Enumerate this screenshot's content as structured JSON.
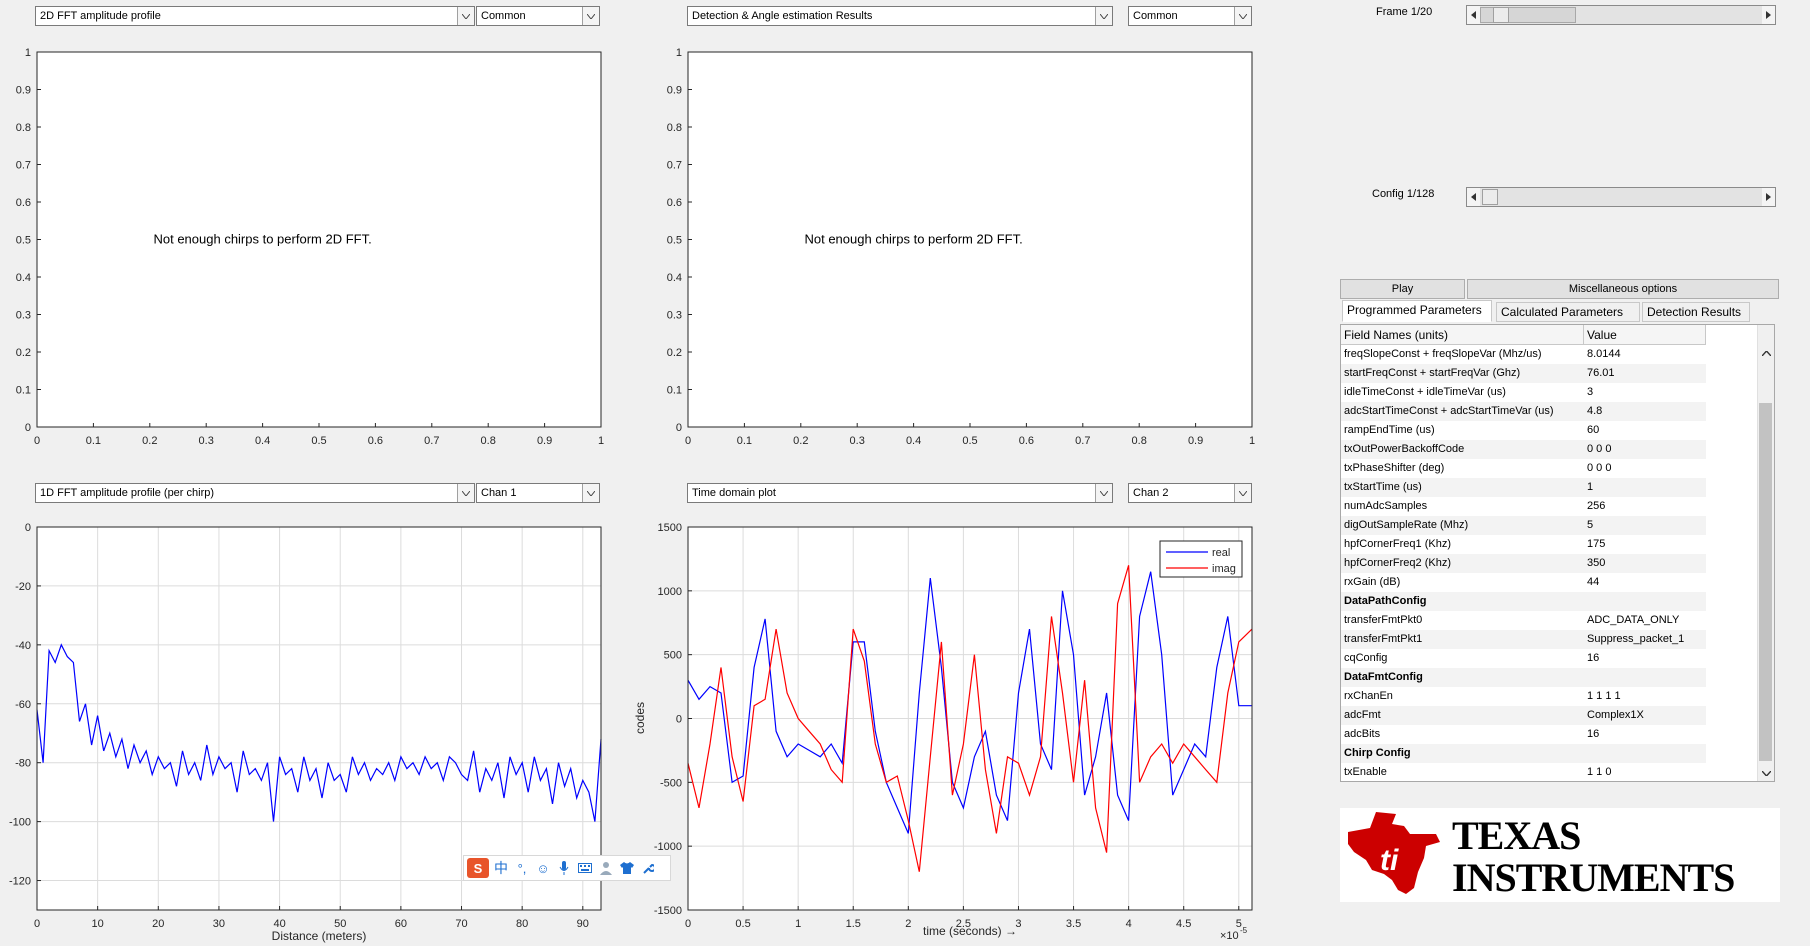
{
  "top_left": {
    "dropdown1": "2D FFT amplitude profile",
    "dropdown2": "Common",
    "message": "Not enough chirps to perform 2D FFT.",
    "yticks": [
      "0",
      "0.1",
      "0.2",
      "0.3",
      "0.4",
      "0.5",
      "0.6",
      "0.7",
      "0.8",
      "0.9",
      "1"
    ],
    "xticks": [
      "0",
      "0.1",
      "0.2",
      "0.3",
      "0.4",
      "0.5",
      "0.6",
      "0.7",
      "0.8",
      "0.9",
      "1"
    ]
  },
  "top_right": {
    "dropdown1": "Detection & Angle estimation Results",
    "dropdown2": "Common",
    "message": "Not enough chirps to perform 2D FFT.",
    "yticks": [
      "0",
      "0.1",
      "0.2",
      "0.3",
      "0.4",
      "0.5",
      "0.6",
      "0.7",
      "0.8",
      "0.9",
      "1"
    ],
    "xticks": [
      "0",
      "0.1",
      "0.2",
      "0.3",
      "0.4",
      "0.5",
      "0.6",
      "0.7",
      "0.8",
      "0.9",
      "1"
    ]
  },
  "bottom_left": {
    "dropdown1": "1D FFT amplitude profile (per chirp)",
    "dropdown2": "Chan 1",
    "xlabel": "Distance (meters)"
  },
  "bottom_right": {
    "dropdown1": "Time domain plot",
    "dropdown2": "Chan 2",
    "xlabel": "time  (seconds) →",
    "ylabel": "codes",
    "exponent": "×10",
    "exponent_power": "-5",
    "legend_real": "real",
    "legend_imag": "imag"
  },
  "controls": {
    "frame_label": "Frame 1/20",
    "frame_value": 0.05,
    "config_label": "Config 1/128",
    "config_value": 0.008,
    "play_button": "Play",
    "misc_button": "Miscellaneous options",
    "tabs": [
      "Programmed Parameters",
      "Calculated Parameters",
      "Detection Results"
    ]
  },
  "table": {
    "headers": [
      "Field Names    (units)",
      "Value"
    ],
    "rows": [
      {
        "name": "freqSlopeConst + freqSlopeVar (Mhz/us)",
        "value": "8.0144",
        "header": false
      },
      {
        "name": "startFreqConst + startFreqVar (Ghz)",
        "value": "76.01",
        "header": false
      },
      {
        "name": "idleTimeConst + idleTimeVar (us)",
        "value": "3",
        "header": false
      },
      {
        "name": "adcStartTimeConst + adcStartTimeVar (us)",
        "value": "4.8",
        "header": false
      },
      {
        "name": "rampEndTime (us)",
        "value": "60",
        "header": false
      },
      {
        "name": "txOutPowerBackoffCode",
        "value": "0 0 0",
        "header": false
      },
      {
        "name": "txPhaseShifter (deg)",
        "value": "0 0 0",
        "header": false
      },
      {
        "name": "txStartTime (us)",
        "value": "1",
        "header": false
      },
      {
        "name": "numAdcSamples",
        "value": "256",
        "header": false
      },
      {
        "name": "digOutSampleRate (Mhz)",
        "value": "5",
        "header": false
      },
      {
        "name": "hpfCornerFreq1 (Khz)",
        "value": "175",
        "header": false
      },
      {
        "name": "hpfCornerFreq2 (Khz)",
        "value": "350",
        "header": false
      },
      {
        "name": "rxGain (dB)",
        "value": "44",
        "header": false
      },
      {
        "name": "DataPathConfig",
        "value": "",
        "header": true
      },
      {
        "name": "transferFmtPkt0",
        "value": "ADC_DATA_ONLY",
        "header": false
      },
      {
        "name": "transferFmtPkt1",
        "value": "Suppress_packet_1",
        "header": false
      },
      {
        "name": "cqConfig",
        "value": "16",
        "header": false
      },
      {
        "name": "DataFmtConfig",
        "value": "",
        "header": true
      },
      {
        "name": "rxChanEn",
        "value": "1 1 1 1",
        "header": false
      },
      {
        "name": "adcFmt",
        "value": "Complex1X",
        "header": false
      },
      {
        "name": "adcBits",
        "value": "16",
        "header": false
      },
      {
        "name": "Chirp Config",
        "value": "",
        "header": true
      },
      {
        "name": "txEnable",
        "value": "1 1 0",
        "header": false
      }
    ]
  },
  "logo": {
    "line1": "TEXAS",
    "line2": "INSTRUMENTS",
    "color": "#cc0000"
  },
  "chart_data": [
    {
      "type": "line",
      "title": "",
      "xlabel": "Distance (meters)",
      "ylabel": "",
      "xlim": [
        0,
        93
      ],
      "ylim": [
        -130,
        0
      ],
      "xticks": [
        0,
        10,
        20,
        30,
        40,
        50,
        60,
        70,
        80,
        90
      ],
      "yticks": [
        0,
        -20,
        -40,
        -60,
        -80,
        -100,
        -120
      ],
      "grid": true,
      "series": [
        {
          "color": "#0000ff",
          "x": [
            0,
            1,
            2,
            3,
            4,
            5,
            6,
            7,
            8,
            9,
            10,
            11,
            12,
            13,
            14,
            15,
            16,
            17,
            18,
            19,
            20,
            21,
            22,
            23,
            24,
            25,
            26,
            27,
            28,
            29,
            30,
            31,
            32,
            33,
            34,
            35,
            36,
            37,
            38,
            39,
            40,
            41,
            42,
            43,
            44,
            45,
            46,
            47,
            48,
            49,
            50,
            51,
            52,
            53,
            54,
            55,
            56,
            57,
            58,
            59,
            60,
            61,
            62,
            63,
            64,
            65,
            66,
            67,
            68,
            69,
            70,
            71,
            72,
            73,
            74,
            75,
            76,
            77,
            78,
            79,
            80,
            81,
            82,
            83,
            84,
            85,
            86,
            87,
            88,
            89,
            90,
            91,
            92,
            93
          ],
          "values": [
            -62,
            -80,
            -42,
            -46,
            -40,
            -44,
            -46,
            -66,
            -60,
            -74,
            -64,
            -76,
            -70,
            -78,
            -72,
            -82,
            -74,
            -80,
            -76,
            -84,
            -78,
            -82,
            -80,
            -88,
            -76,
            -84,
            -80,
            -86,
            -74,
            -84,
            -78,
            -82,
            -80,
            -90,
            -76,
            -84,
            -82,
            -86,
            -80,
            -100,
            -78,
            -84,
            -82,
            -90,
            -78,
            -86,
            -82,
            -92,
            -80,
            -86,
            -84,
            -90,
            -78,
            -84,
            -80,
            -86,
            -82,
            -84,
            -80,
            -86,
            -78,
            -82,
            -80,
            -84,
            -78,
            -82,
            -80,
            -86,
            -78,
            -80,
            -84,
            -86,
            -76,
            -90,
            -82,
            -86,
            -80,
            -92,
            -78,
            -84,
            -80,
            -90,
            -78,
            -86,
            -82,
            -94,
            -80,
            -88,
            -82,
            -92,
            -86,
            -90,
            -100,
            -72
          ]
        }
      ]
    },
    {
      "type": "line",
      "title": "",
      "xlabel": "time  (seconds) →",
      "ylabel": "codes",
      "xlim": [
        0,
        5.12
      ],
      "ylim": [
        -1500,
        1500
      ],
      "xticks": [
        0,
        0.5,
        1,
        1.5,
        2,
        2.5,
        3,
        3.5,
        4,
        4.5,
        5
      ],
      "yticks": [
        1500,
        1000,
        500,
        0,
        -500,
        -1000,
        -1500
      ],
      "grid": true,
      "legend": "top-right",
      "series": [
        {
          "name": "real",
          "color": "#0000ff",
          "x": [
            0,
            0.1,
            0.2,
            0.3,
            0.4,
            0.5,
            0.6,
            0.7,
            0.8,
            0.9,
            1.0,
            1.1,
            1.2,
            1.3,
            1.4,
            1.5,
            1.6,
            1.7,
            1.8,
            1.9,
            2.0,
            2.1,
            2.2,
            2.3,
            2.4,
            2.5,
            2.6,
            2.7,
            2.8,
            2.9,
            3.0,
            3.1,
            3.2,
            3.3,
            3.4,
            3.5,
            3.6,
            3.7,
            3.8,
            3.9,
            4.0,
            4.1,
            4.2,
            4.3,
            4.4,
            4.5,
            4.6,
            4.7,
            4.8,
            4.9,
            5.0,
            5.12
          ],
          "values": [
            300,
            150,
            250,
            200,
            -500,
            -450,
            400,
            780,
            -100,
            -300,
            -200,
            -250,
            -300,
            -200,
            -350,
            600,
            600,
            -100,
            -500,
            -700,
            -900,
            200,
            1100,
            400,
            -500,
            -700,
            -300,
            -100,
            -600,
            -800,
            200,
            700,
            -200,
            -400,
            1000,
            500,
            -600,
            -300,
            200,
            -600,
            -800,
            800,
            1150,
            500,
            -600,
            -400,
            -200,
            -300,
            400,
            800,
            100,
            100
          ]
        },
        {
          "name": "imag",
          "color": "#ff0000",
          "x": [
            0,
            0.1,
            0.2,
            0.3,
            0.4,
            0.5,
            0.6,
            0.7,
            0.8,
            0.9,
            1.0,
            1.1,
            1.2,
            1.3,
            1.4,
            1.5,
            1.6,
            1.7,
            1.8,
            1.9,
            2.0,
            2.1,
            2.2,
            2.3,
            2.4,
            2.5,
            2.6,
            2.7,
            2.8,
            2.9,
            3.0,
            3.1,
            3.2,
            3.3,
            3.4,
            3.5,
            3.6,
            3.7,
            3.8,
            3.9,
            4.0,
            4.1,
            4.2,
            4.3,
            4.4,
            4.5,
            4.6,
            4.7,
            4.8,
            4.9,
            5.0,
            5.12
          ],
          "values": [
            -350,
            -700,
            -200,
            400,
            -300,
            -650,
            100,
            150,
            700,
            200,
            0,
            -100,
            -200,
            -400,
            -500,
            700,
            450,
            -200,
            -500,
            -450,
            -800,
            -1200,
            -300,
            600,
            -600,
            -200,
            500,
            -400,
            -900,
            -300,
            -350,
            -600,
            -300,
            800,
            200,
            -500,
            300,
            -700,
            -1050,
            900,
            1200,
            -500,
            -300,
            -200,
            -350,
            -200,
            -300,
            -400,
            -500,
            200,
            600,
            700
          ]
        }
      ]
    }
  ]
}
